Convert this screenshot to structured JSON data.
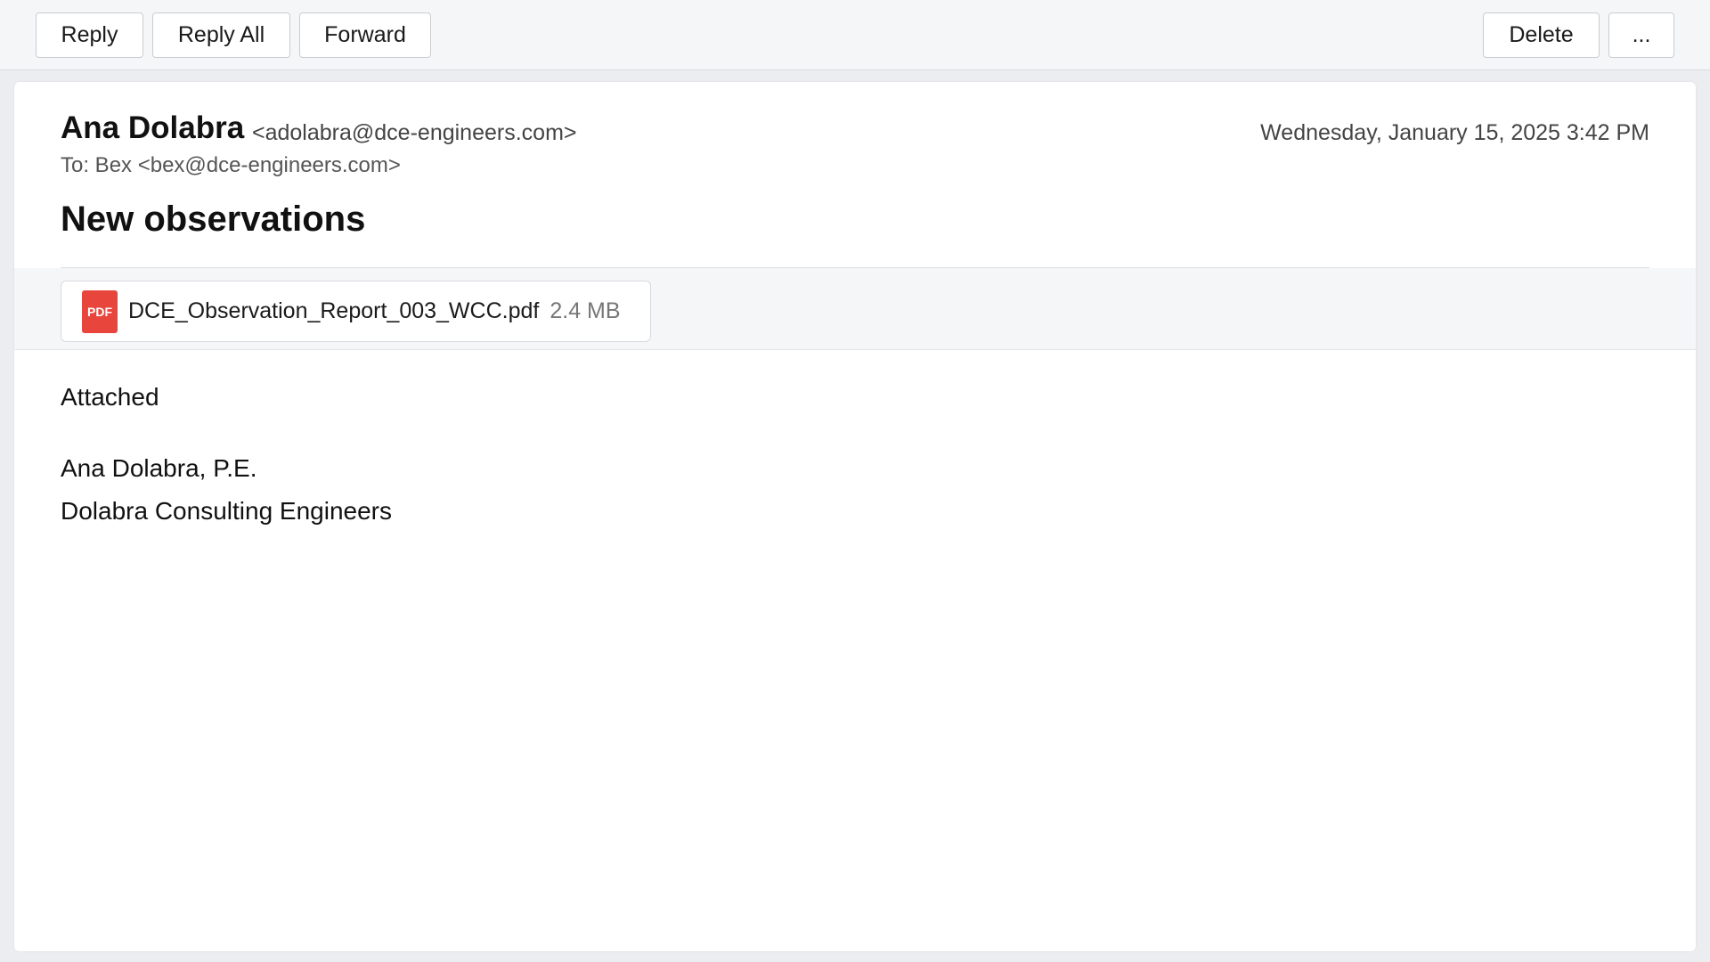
{
  "toolbar": {
    "reply_label": "Reply",
    "reply_all_label": "Reply All",
    "forward_label": "Forward",
    "delete_label": "Delete",
    "more_label": "..."
  },
  "message": {
    "sender_name": "Ana Dolabra",
    "sender_email": "<adolabra@dce-engineers.com>",
    "date": "Wednesday, January 15, 2025 3:42 PM",
    "to_line": "To: Bex <bex@dce-engineers.com>",
    "subject": "New observations",
    "attachment": {
      "icon_label": "PDF",
      "file_name": "DCE_Observation_Report_003_WCC.pdf",
      "file_size": "2.4 MB"
    },
    "body": {
      "line1": "Attached",
      "signature_name": "Ana Dolabra, P.E.",
      "signature_company": "Dolabra Consulting Engineers"
    }
  },
  "colors": {
    "pdf_icon": "#e8453c",
    "toolbar_bg": "#f5f6f8",
    "page_bg": "#ebedf0"
  }
}
